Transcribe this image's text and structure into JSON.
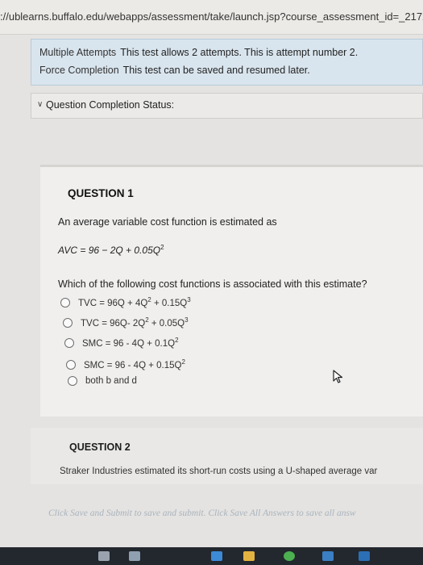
{
  "browser": {
    "url": "://ublearns.buffalo.edu/webapps/assessment/take/launch.jsp?course_assessment_id=_217234"
  },
  "test_info": {
    "multiple_attempts_label": "Multiple Attempts",
    "multiple_attempts_text": "This test allows 2 attempts. This is attempt number 2.",
    "force_completion_label": "Force Completion",
    "force_completion_text": "This test can be saved and resumed later."
  },
  "status": {
    "label": "Question Completion Status:"
  },
  "question1": {
    "title": "QUESTION 1",
    "intro": "An average variable cost function is estimated as",
    "formula": {
      "prefix": "AVC = 96 − 2Q + 0.05Q",
      "exp": "2"
    },
    "question": "Which of the following cost functions is associated with this estimate?",
    "choices": [
      {
        "a": "TVC = 96Q + 4Q",
        "a_exp": "2",
        "b": " + 0.15Q",
        "b_exp": "3"
      },
      {
        "a": "TVC = 96Q- 2Q",
        "a_exp": "2",
        "b": " + 0.05Q",
        "b_exp": "3"
      },
      {
        "a": "SMC = 96 - 4Q + 0.1Q",
        "a_exp": "2",
        "b": "",
        "b_exp": ""
      },
      {
        "a": "SMC = 96 - 4Q + 0.15Q",
        "a_exp": "2",
        "b": "",
        "b_exp": ""
      },
      {
        "a": "both b and d",
        "a_exp": "",
        "b": "",
        "b_exp": ""
      }
    ]
  },
  "question2": {
    "title": "QUESTION 2",
    "text": "Straker Industries estimated its short-run costs using a U-shaped average var"
  },
  "footer": {
    "note": "Click Save and Submit to save and submit. Click Save All Answers to save all answ"
  },
  "taskbar": {
    "icons": [
      {
        "name": "task-view-icon",
        "color": "#9aa3ad"
      },
      {
        "name": "calculator-icon",
        "color": "#8fa0b0"
      },
      {
        "name": "mail-icon",
        "color": "#3d8ad6"
      },
      {
        "name": "folder-icon",
        "color": "#e3b341"
      },
      {
        "name": "chrome-icon",
        "color": "#4caf50"
      },
      {
        "name": "store-icon",
        "color": "#3b7fc4"
      },
      {
        "name": "edge-icon",
        "color": "#2b6fb5"
      }
    ]
  }
}
